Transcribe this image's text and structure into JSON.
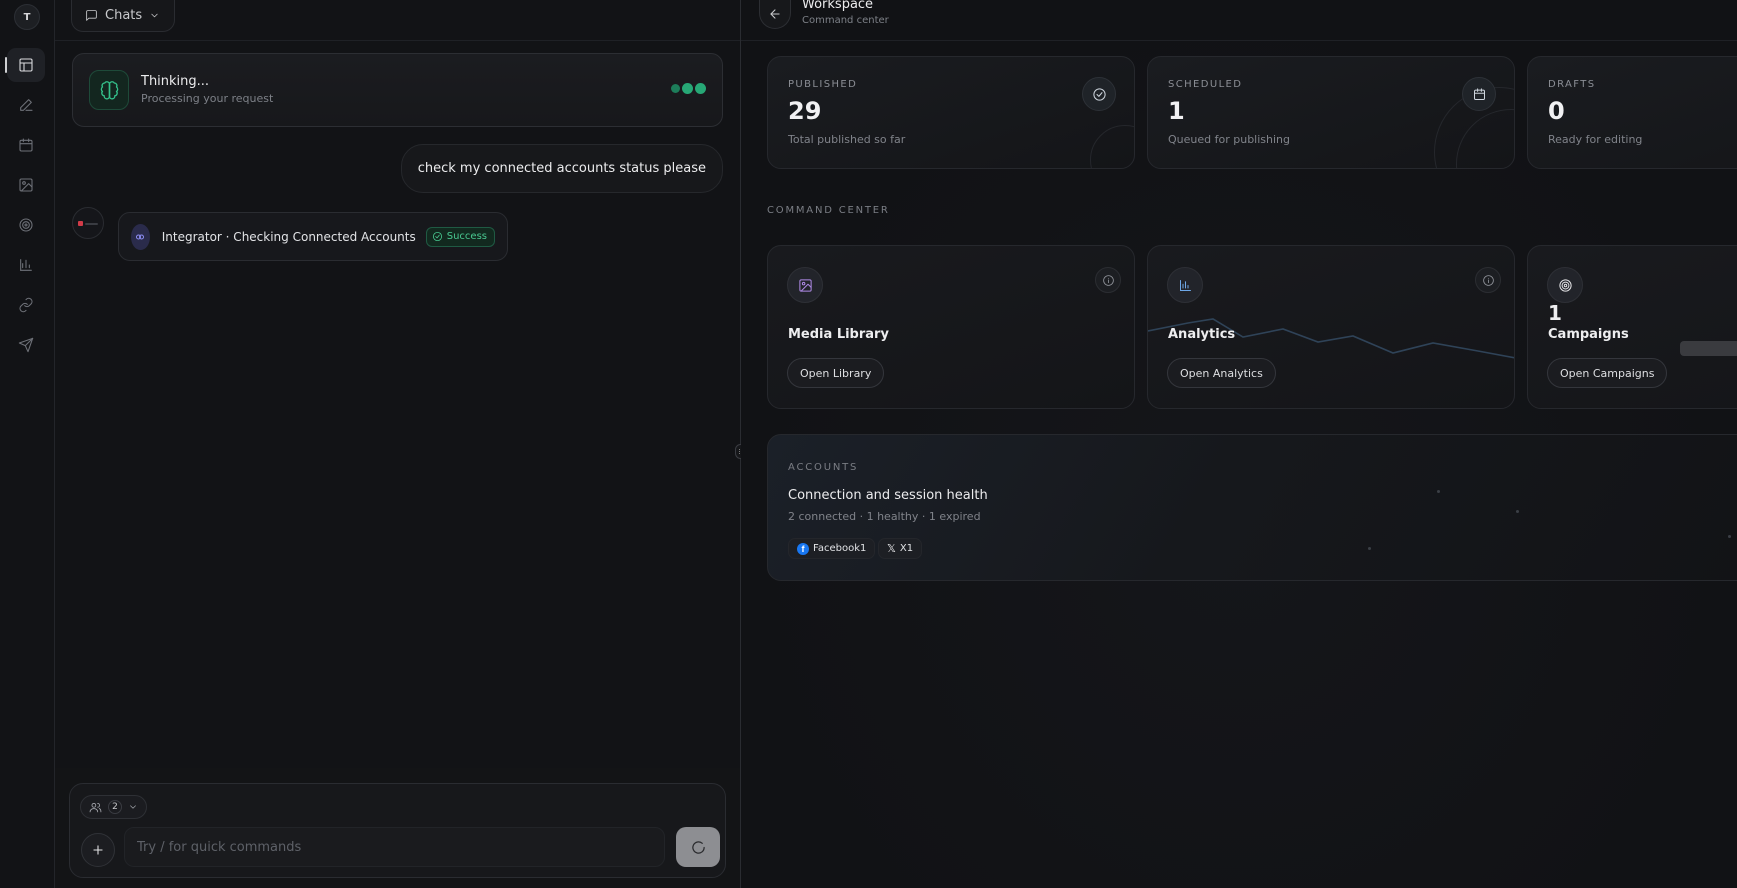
{
  "user": {
    "initial": "T"
  },
  "rail": {
    "items": [
      {
        "icon": "layout-icon",
        "active": true
      },
      {
        "icon": "edit-icon",
        "active": false
      },
      {
        "icon": "calendar-icon",
        "active": false
      },
      {
        "icon": "image-icon",
        "active": false
      },
      {
        "icon": "target-icon",
        "active": false
      },
      {
        "icon": "bar-chart-icon",
        "active": false
      },
      {
        "icon": "link-icon",
        "active": false
      },
      {
        "icon": "send-icon",
        "active": false
      }
    ]
  },
  "chat": {
    "chats_label": "Chats",
    "thinking": {
      "title": "Thinking...",
      "subtitle": "Processing your request"
    },
    "user_message": "check my connected accounts status please",
    "tool_call": {
      "label": "Integrator · Checking Connected Accounts",
      "status": "Success"
    },
    "composer": {
      "agents_count": "2",
      "placeholder": "Try / for quick commands"
    }
  },
  "workspace": {
    "title": "Workspace",
    "subtitle": "Command center",
    "stats": [
      {
        "label": "PUBLISHED",
        "value": "29",
        "caption": "Total published so far",
        "icon": "check-circle-icon"
      },
      {
        "label": "SCHEDULED",
        "value": "1",
        "caption": "Queued for publishing",
        "icon": "calendar-icon"
      },
      {
        "label": "DRAFTS",
        "value": "0",
        "caption": "Ready for editing",
        "icon": ""
      }
    ],
    "section_label": "COMMAND CENTER",
    "modules": [
      {
        "title": "Media Library",
        "button": "Open Library",
        "icon": "image-icon",
        "count": ""
      },
      {
        "title": "Analytics",
        "button": "Open Analytics",
        "icon": "bar-chart-icon",
        "count": ""
      },
      {
        "title": "Campaigns",
        "button": "Open Campaigns",
        "icon": "target-icon",
        "count": "1"
      }
    ],
    "accounts": {
      "label": "ACCOUNTS",
      "title": "Connection and session health",
      "summary": "2 connected · 1 healthy · 1 expired",
      "chips": [
        {
          "platform": "facebook",
          "name": "Facebook1"
        },
        {
          "platform": "x",
          "name": "X1"
        }
      ]
    }
  },
  "colors": {
    "accent_green": "#27a876",
    "success": "#49c991",
    "integrator_purple": "#8e8ef5",
    "facebook_blue": "#1877f2",
    "media_icon": "#b08ae8",
    "analytics_icon": "#6ea8e8"
  }
}
